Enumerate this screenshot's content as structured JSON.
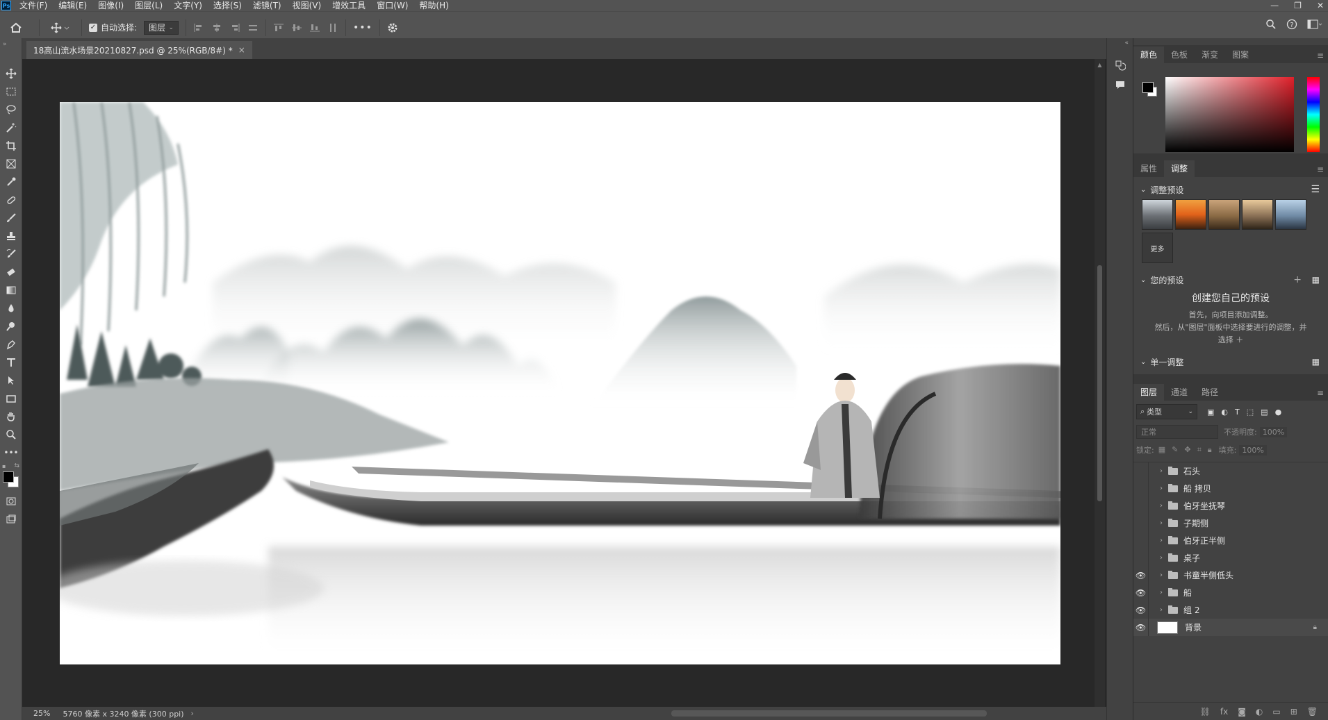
{
  "app": {
    "logo": "Ps"
  },
  "menu": [
    "文件(F)",
    "编辑(E)",
    "图像(I)",
    "图层(L)",
    "文字(Y)",
    "选择(S)",
    "滤镜(T)",
    "视图(V)",
    "增效工具",
    "窗口(W)",
    "帮助(H)"
  ],
  "options": {
    "auto_select_label": "自动选择:",
    "auto_select_value": "图层",
    "more": "•••"
  },
  "document": {
    "tab_title": "18高山流水场景20210827.psd @ 25%(RGB/8#) *",
    "close": "×"
  },
  "status": {
    "zoom": "25%",
    "info": "5760 像素 x 3240 像素 (300 ppi)",
    "arrow": "›"
  },
  "color_panel": {
    "tabs": [
      "颜色",
      "色板",
      "渐变",
      "图案"
    ],
    "foreground": "#000000",
    "background": "#ffffff"
  },
  "adjust_panel": {
    "tabs": [
      "属性",
      "调整"
    ],
    "presets_title": "调整预设",
    "more_label": "更多",
    "your_presets_title": "您的预设",
    "create_title": "创建您自己的预设",
    "create_line1": "首先，向项目添加调整。",
    "create_line2": "然后，从\"图层\"面板中选择要进行的调整，并",
    "create_line3": "选择 ＋",
    "single_adjust_title": "单一调整"
  },
  "layers_panel": {
    "tabs": [
      "图层",
      "通道",
      "路径"
    ],
    "filter_kind": "类型",
    "blend_mode": "正常",
    "opacity_label": "不透明度:",
    "opacity_value": "100%",
    "lock_label": "锁定:",
    "fill_label": "填充:",
    "fill_value": "100%",
    "layers": [
      {
        "name": "石头",
        "visible": false
      },
      {
        "name": "船 拷贝",
        "visible": false
      },
      {
        "name": "伯牙坐抚琴",
        "visible": false
      },
      {
        "name": "子期侧",
        "visible": false
      },
      {
        "name": "伯牙正半侧",
        "visible": false
      },
      {
        "name": "桌子",
        "visible": false
      },
      {
        "name": "书童半侧低头",
        "visible": true
      },
      {
        "name": "船",
        "visible": true
      },
      {
        "name": "组 2",
        "visible": true
      }
    ],
    "background_layer": "背景"
  },
  "icons": {
    "tools": [
      "move-icon",
      "marquee-icon",
      "lasso-icon",
      "magic-wand-icon",
      "crop-icon",
      "frame-icon",
      "eyedropper-icon",
      "healing-icon",
      "brush-icon",
      "stamp-icon",
      "history-brush-icon",
      "eraser-icon",
      "gradient-icon",
      "blur-icon",
      "dodge-icon",
      "pen-icon",
      "type-icon",
      "path-select-icon",
      "shape-icon",
      "hand-icon",
      "zoom-icon",
      "more-tools-icon"
    ]
  }
}
